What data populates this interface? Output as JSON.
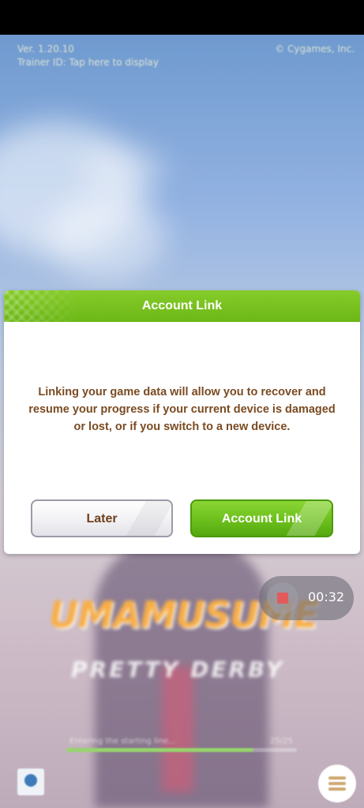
{
  "game": {
    "version": "Ver. 1.20.10",
    "trainer_id": "Trainer ID: Tap here to display",
    "copyright": "© Cygames, Inc.",
    "logo_main": "UMAMUSUME",
    "logo_sub": "PRETTY DERBY",
    "loading_label": "Entering the starting line...",
    "loading_percent_text": "25/25",
    "loading_progress": 0.81,
    "menu_icon": "hamburger-menu-icon",
    "bottom_left_icon": "support-icon"
  },
  "dialog": {
    "title": "Account Link",
    "message": "Linking your game data will allow you to recover and resume your progress if your current device is damaged or lost, or if you switch to a new device.",
    "buttons": {
      "later": "Later",
      "account_link": "Account Link"
    }
  },
  "recorder": {
    "time": "00:32",
    "stop_icon": "stop-icon"
  },
  "colors": {
    "header_green": "#7ac220",
    "button_green": "#6cc01c",
    "body_text_brown": "#7a4b22",
    "later_text_brown": "#6e3f1c",
    "recorder_red": "#e25a5a"
  }
}
